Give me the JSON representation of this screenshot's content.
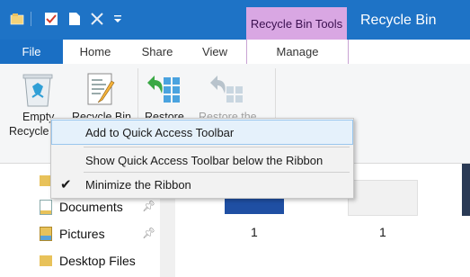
{
  "titlebar": {
    "context_group": "Recycle Bin Tools",
    "title": "Recycle Bin",
    "quick_access": [
      "explorer-icon",
      "properties-checkmark-icon",
      "new-folder-icon",
      "delete-x-icon",
      "customize-dropdown-icon"
    ]
  },
  "tabs": {
    "file": "File",
    "home": "Home",
    "share": "Share",
    "view": "View",
    "manage": "Manage"
  },
  "ribbon": {
    "empty_label": "Empty",
    "empty_label2": "Recycle",
    "properties_label": "Recycle Bin",
    "restore_label": "Restore",
    "restore_selected_label": "Restore the"
  },
  "menu": {
    "item1": "Add to Quick Access Toolbar",
    "item2": "Show Quick Access Toolbar below the Ribbon",
    "item3": "Minimize the Ribbon",
    "item3_checked": true
  },
  "nav": {
    "items": [
      {
        "label": "Documents",
        "pinned": true
      },
      {
        "label": "Pictures",
        "pinned": true
      },
      {
        "label": "Desktop Files",
        "pinned": false
      }
    ]
  },
  "content": {
    "counts": [
      "1",
      "1"
    ]
  },
  "colors": {
    "titlebar": "#1e73c6",
    "context_tab": "#d9a7e3",
    "menu_hover": "#e5f1fb"
  }
}
